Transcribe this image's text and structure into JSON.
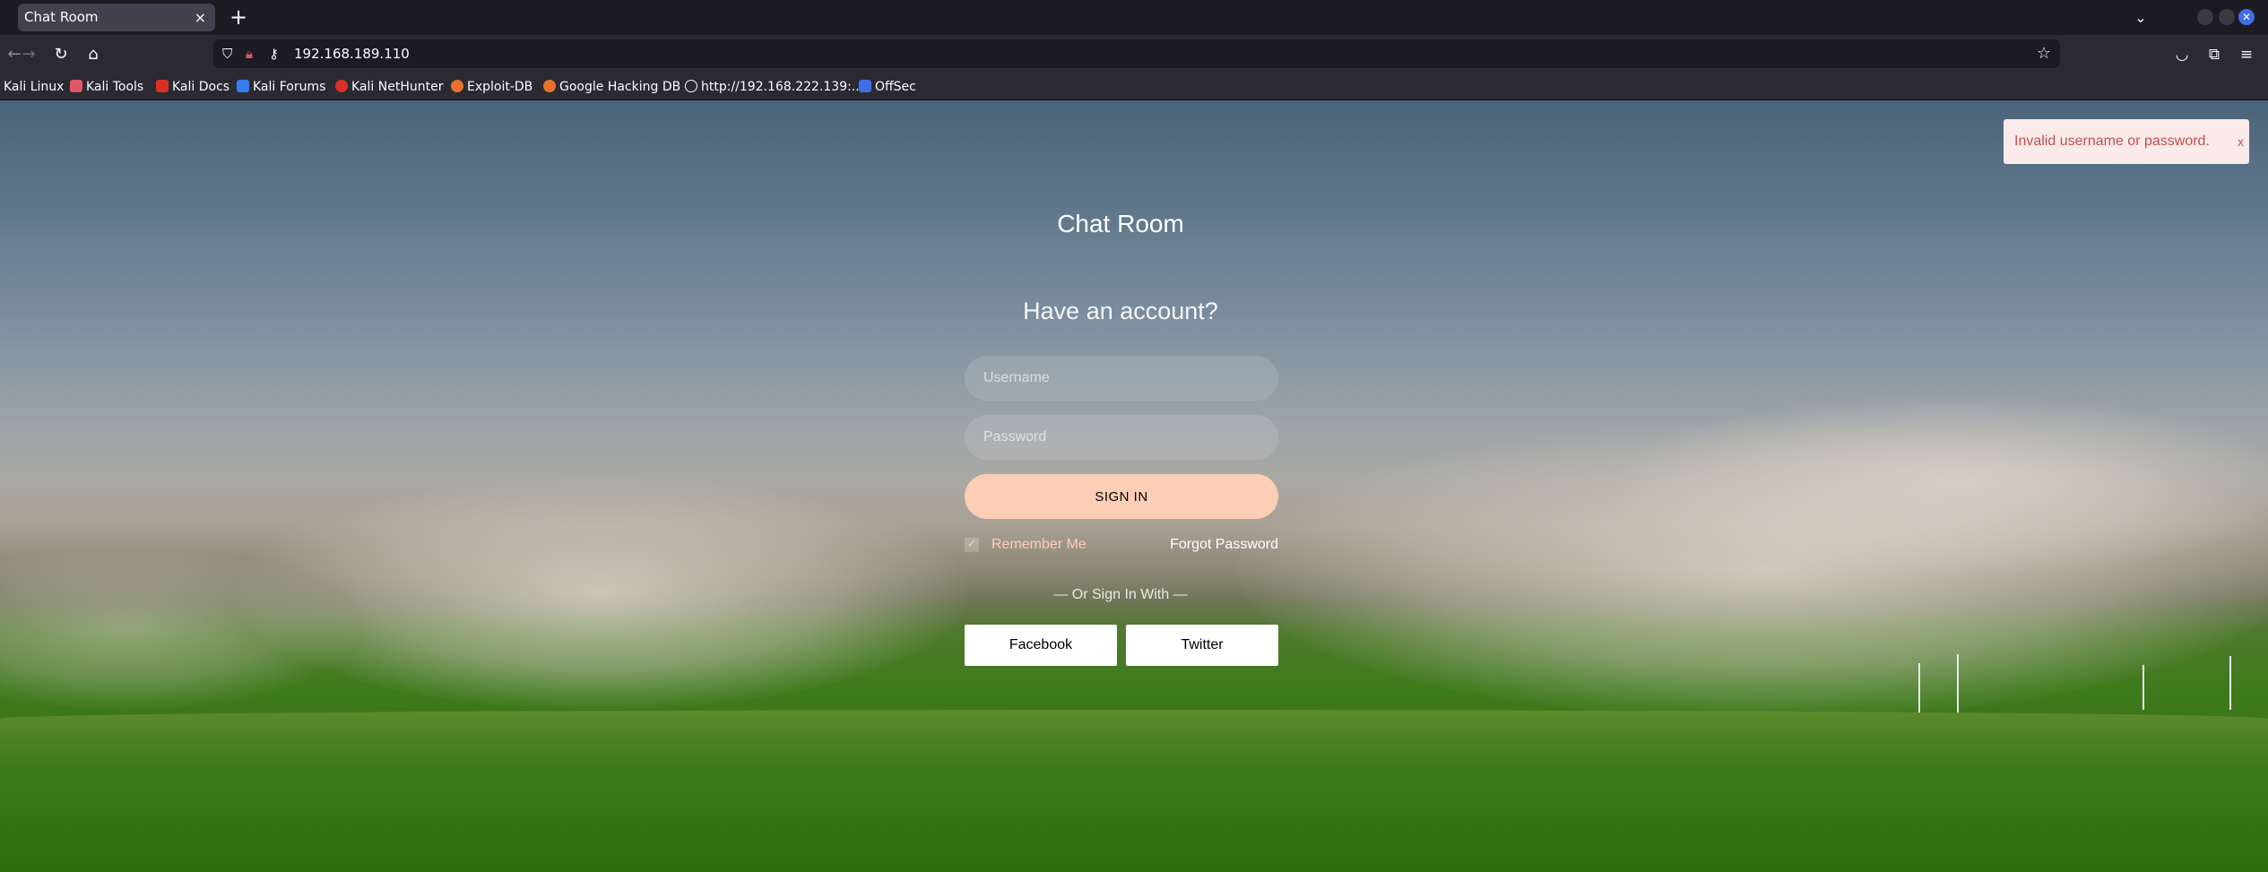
{
  "browser": {
    "tab_title": "Chat Room",
    "tab_close": "×",
    "new_tab": "+",
    "url": "192.168.189.110",
    "bookmarks": [
      {
        "label": "Kali Linux",
        "color": "#367bf0"
      },
      {
        "label": "Kali Tools",
        "color": "#e2566a"
      },
      {
        "label": "Kali Docs",
        "color": "#d93025"
      },
      {
        "label": "Kali Forums",
        "color": "#367bf0"
      },
      {
        "label": "Kali NetHunter",
        "color": "#d93025"
      },
      {
        "label": "Exploit-DB",
        "color": "#e8722c"
      },
      {
        "label": "Google Hacking DB",
        "color": "#e8722c"
      },
      {
        "label": "http://192.168.222.139:...",
        "color": "#fbfbfe"
      },
      {
        "label": "OffSec",
        "color": "#3f6ee8"
      }
    ]
  },
  "login": {
    "title": "Chat Room",
    "heading": "Have an account?",
    "username_placeholder": "Username",
    "password_placeholder": "Password",
    "signin_label": "SIGN IN",
    "remember_label": "Remember Me",
    "remember_checked": true,
    "forgot_label": "Forgot Password",
    "or_signin": "— Or Sign In With —",
    "facebook_label": "Facebook",
    "twitter_label": "Twitter"
  },
  "toast": {
    "message": "Invalid username or password.",
    "close": "x"
  },
  "colors": {
    "accent": "#fbceb5",
    "toast_text": "#c0504d",
    "toast_bg": "#fbeaea"
  }
}
